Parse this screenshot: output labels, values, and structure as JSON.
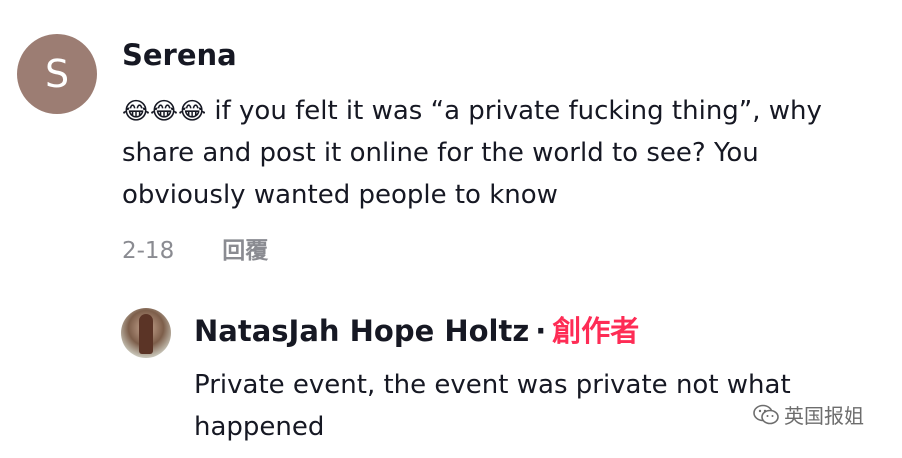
{
  "comment": {
    "avatar_letter": "S",
    "username": "Serena",
    "emojis": "😂😂😂",
    "text": " if you felt it was “a private fucking thing”, why share and post it online for the world to see? You obviously wanted people to know",
    "date": "2-18",
    "reply_label": "回覆"
  },
  "reply": {
    "username": "NatasJah Hope Holtz",
    "separator": "·",
    "creator_label": "創作者",
    "text": "Private event, the event was private not what happened"
  },
  "watermark": {
    "text": "英国报姐",
    "icon": "wechat-icon"
  },
  "colors": {
    "avatar_bg": "#9c7d73",
    "creator_accent": "#fe2c55",
    "meta_gray": "#8a8b91",
    "text": "#161823"
  }
}
